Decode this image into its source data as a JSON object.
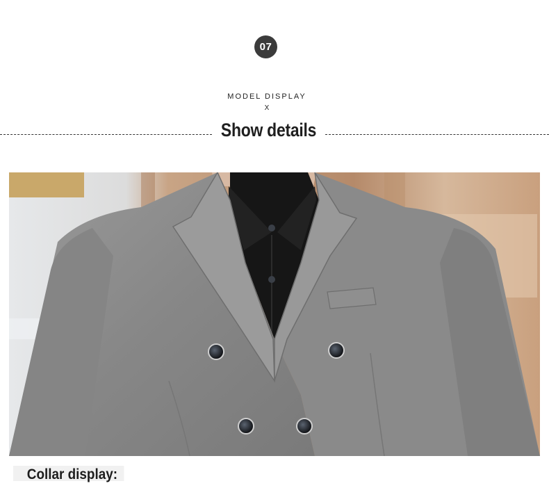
{
  "section": {
    "number": "07",
    "subtitle_line1": "MODEL DISPLAY",
    "subtitle_line2": "X",
    "heading": "Show details"
  },
  "photo": {
    "icon": "jacket-photo"
  },
  "caption": {
    "text": "Collar display:"
  },
  "colors": {
    "badge": "#3b3b3b",
    "jacket": "#8e8e8e",
    "shirt": "#1a1a1a"
  }
}
